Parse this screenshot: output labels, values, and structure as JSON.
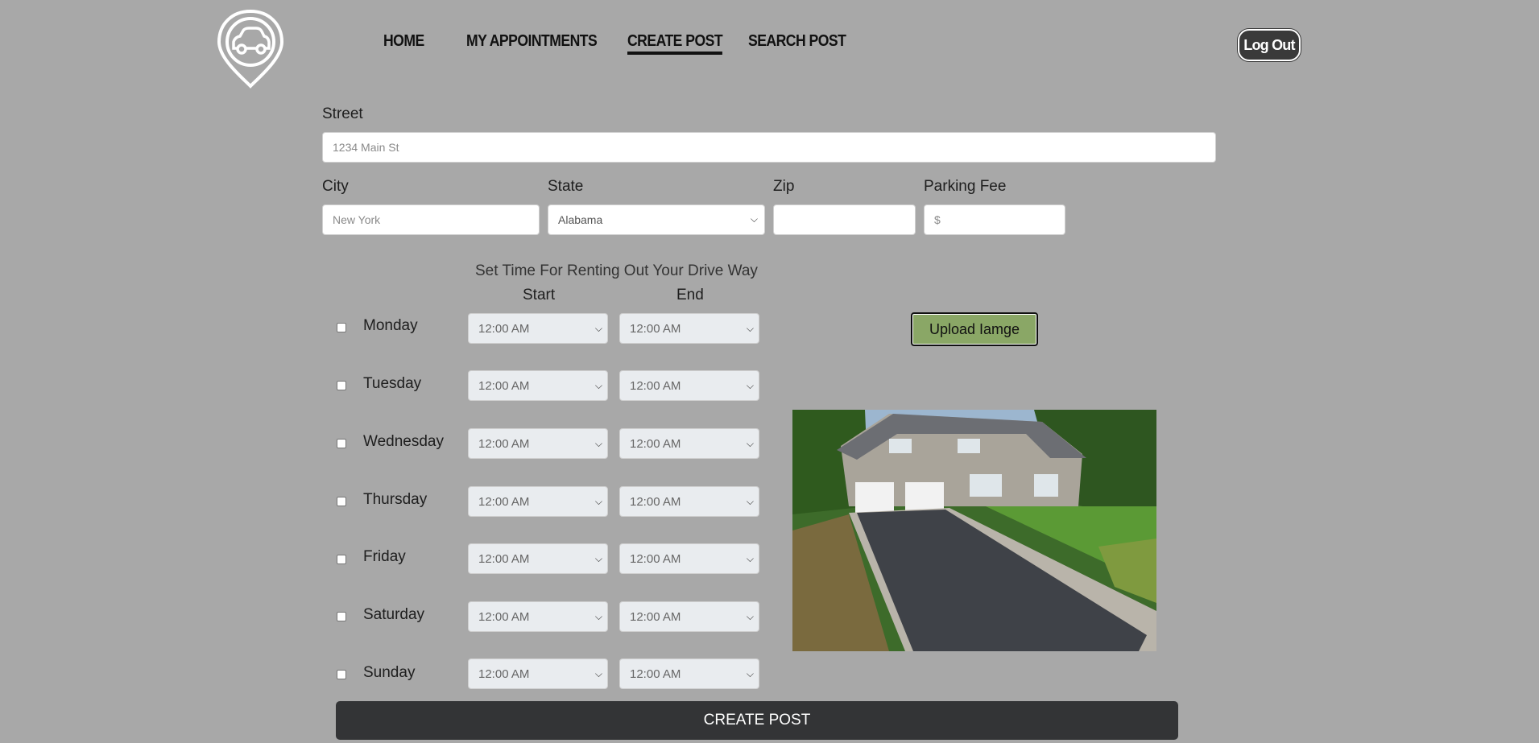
{
  "nav": {
    "items": [
      {
        "label": "HOME"
      },
      {
        "label": "MY APPOINTMENTS"
      },
      {
        "label": "CREATE POST",
        "active": true
      },
      {
        "label": "SEARCH POST"
      }
    ],
    "logout_label": "Log Out"
  },
  "form": {
    "street": {
      "label": "Street",
      "placeholder": "1234 Main St"
    },
    "city": {
      "label": "City",
      "placeholder": "New York"
    },
    "state": {
      "label": "State",
      "value": "Alabama"
    },
    "zip": {
      "label": "Zip",
      "value": ""
    },
    "fee": {
      "label": "Parking Fee",
      "placeholder": "$"
    }
  },
  "schedule": {
    "title": "Set Time For Renting Out Your Drive Way",
    "start_header": "Start",
    "end_header": "End",
    "days": [
      {
        "name": "Monday",
        "start": "12:00 AM",
        "end": "12:00 AM",
        "checked": false
      },
      {
        "name": "Tuesday",
        "start": "12:00 AM",
        "end": "12:00 AM",
        "checked": false
      },
      {
        "name": "Wednesday",
        "start": "12:00 AM",
        "end": "12:00 AM",
        "checked": false
      },
      {
        "name": "Thursday",
        "start": "12:00 AM",
        "end": "12:00 AM",
        "checked": false
      },
      {
        "name": "Friday",
        "start": "12:00 AM",
        "end": "12:00 AM",
        "checked": false
      },
      {
        "name": "Saturday",
        "start": "12:00 AM",
        "end": "12:00 AM",
        "checked": false
      },
      {
        "name": "Sunday",
        "start": "12:00 AM",
        "end": "12:00 AM",
        "checked": false
      }
    ]
  },
  "upload_label": "Upload Iamge",
  "submit_label": "CREATE POST",
  "colors": {
    "background": "#a8a8a8",
    "button_dark": "#333436",
    "upload_green": "#8aa766"
  }
}
